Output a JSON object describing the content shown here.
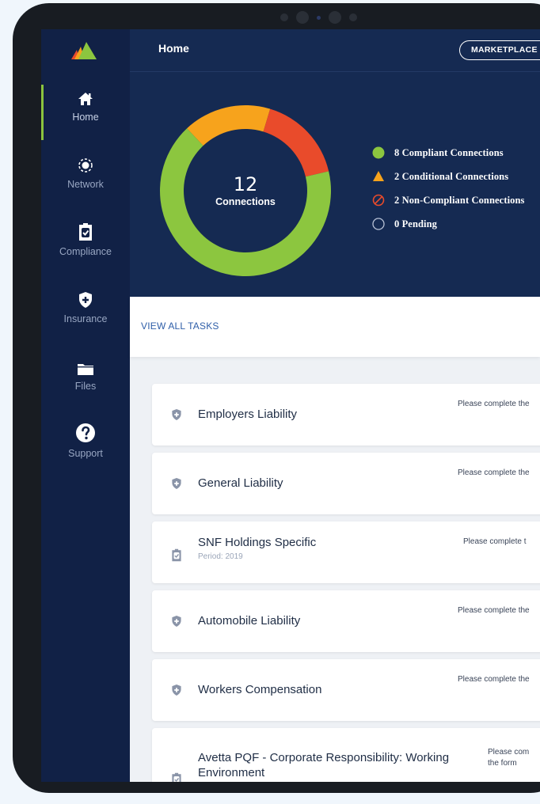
{
  "header": {
    "title": "Home",
    "marketplace_label": "MARKETPLACE"
  },
  "sidebar": {
    "items": [
      {
        "label": "Home",
        "icon": "home-icon"
      },
      {
        "label": "Network",
        "icon": "network-icon"
      },
      {
        "label": "Compliance",
        "icon": "clipboard-check-icon"
      },
      {
        "label": "Insurance",
        "icon": "shield-plus-icon"
      },
      {
        "label": "Files",
        "icon": "folder-icon"
      },
      {
        "label": "Support",
        "icon": "question-icon"
      }
    ]
  },
  "summary": {
    "total": "12",
    "total_label": "Connections",
    "legend": [
      {
        "label": "8  Compliant Connections",
        "value": 8,
        "color": "#8cc63f"
      },
      {
        "label": "2  Conditional Connections",
        "value": 2,
        "color": "#f7a31c"
      },
      {
        "label": "2  Non-Compliant Connections",
        "value": 2,
        "color": "#e94b2b"
      },
      {
        "label": "0  Pending",
        "value": 0,
        "color": "#ffffff"
      }
    ]
  },
  "tasks": {
    "view_all_label": "VIEW ALL TASKS",
    "items": [
      {
        "title": "Employers Liability",
        "subtitle": "",
        "note": "Please complete the",
        "icon": "shield-plus-icon"
      },
      {
        "title": "General Liability",
        "subtitle": "",
        "note": "Please complete the",
        "icon": "shield-plus-icon"
      },
      {
        "title": "SNF Holdings Specific",
        "subtitle": "Period: 2019",
        "note": "Please complete t",
        "icon": "clipboard-check-icon"
      },
      {
        "title": "Automobile Liability",
        "subtitle": "",
        "note": "Please complete the",
        "icon": "shield-plus-icon"
      },
      {
        "title": "Workers Compensation",
        "subtitle": "",
        "note": "Please complete the",
        "icon": "shield-plus-icon"
      },
      {
        "title": "Avetta PQF - Corporate Responsibility: Working Environment",
        "subtitle": "",
        "note": "Please com",
        "note2": "the form",
        "icon": "clipboard-check-icon"
      }
    ]
  }
}
